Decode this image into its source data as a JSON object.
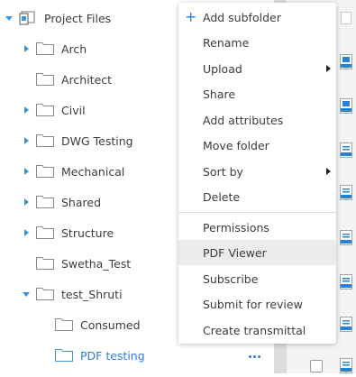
{
  "tree": {
    "root": {
      "label": "Project Files"
    },
    "items": [
      {
        "label": "Arch",
        "expanded": false,
        "has_children": true
      },
      {
        "label": "Architect",
        "expanded": false,
        "has_children": false
      },
      {
        "label": "Civil",
        "expanded": false,
        "has_children": true
      },
      {
        "label": "DWG Testing",
        "expanded": false,
        "has_children": true
      },
      {
        "label": "Mechanical",
        "expanded": false,
        "has_children": true
      },
      {
        "label": "Shared",
        "expanded": false,
        "has_children": true
      },
      {
        "label": "Structure",
        "expanded": false,
        "has_children": true
      },
      {
        "label": "Swetha_Test",
        "expanded": false,
        "has_children": false
      },
      {
        "label": "test_Shruti",
        "expanded": true,
        "has_children": true
      },
      {
        "label": "Consumed",
        "expanded": false,
        "has_children": false
      },
      {
        "label": "PDF testing",
        "expanded": false,
        "has_children": false,
        "selected": true
      }
    ]
  },
  "context_menu": {
    "items": [
      {
        "label": "Add subfolder"
      },
      {
        "label": "Rename"
      },
      {
        "label": "Upload"
      },
      {
        "label": "Share"
      },
      {
        "label": "Add attributes"
      },
      {
        "label": "Move folder"
      },
      {
        "label": "Sort by"
      },
      {
        "label": "Delete"
      },
      {
        "label": "Permissions"
      },
      {
        "label": "PDF Viewer"
      },
      {
        "label": "Subscribe"
      },
      {
        "label": "Submit for review"
      },
      {
        "label": "Create transmittal"
      }
    ]
  },
  "file_icons": [
    {
      "type": "DWF"
    },
    {
      "type": "DWF"
    },
    {
      "type": "PDF"
    },
    {
      "type": "PDF"
    },
    {
      "type": "PDF"
    },
    {
      "type": "PDF"
    },
    {
      "type": "PDF"
    },
    {
      "type": "PDF"
    }
  ],
  "colors": {
    "accent": "#2b7fd6",
    "folder_outline": "#8a8a8a",
    "selected_text": "#2b7fd6",
    "caret": "#3d95d6"
  }
}
